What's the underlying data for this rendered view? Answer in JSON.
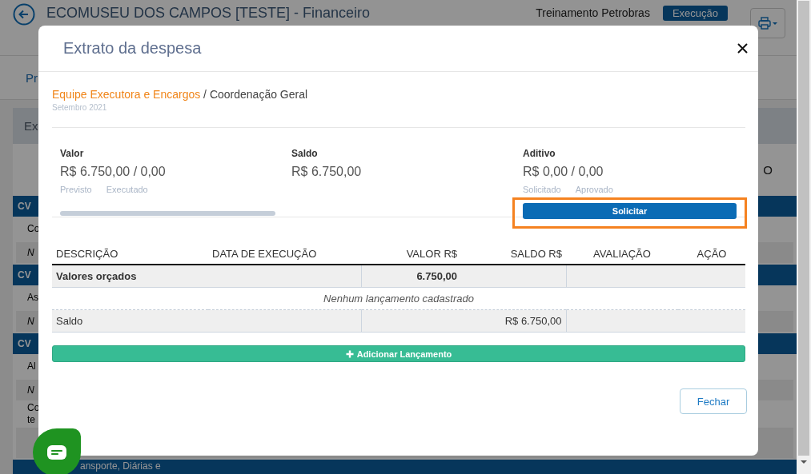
{
  "background": {
    "title": "ECOMUSEU DOS CAMPOS [TESTE] - Financeiro",
    "project": "Treinamento Petrobras",
    "status": "Execução",
    "tab": "Pr",
    "section": "Ex",
    "column_fragment": "O",
    "rows": [
      {
        "kind": "group",
        "label": "CV"
      },
      {
        "kind": "item",
        "label": "Co"
      },
      {
        "kind": "note",
        "label": "N"
      },
      {
        "kind": "group",
        "label": "CV"
      },
      {
        "kind": "item",
        "label": "As"
      },
      {
        "kind": "note",
        "label": "N"
      },
      {
        "kind": "group",
        "label": "CV"
      },
      {
        "kind": "item",
        "label": "Al"
      },
      {
        "kind": "note",
        "label": "N"
      },
      {
        "kind": "item",
        "label": "Co te"
      },
      {
        "kind": "note",
        "label": ""
      },
      {
        "kind": "group",
        "label": "ansporte, Diárias e"
      }
    ]
  },
  "modal": {
    "title": "Extrato da despesa",
    "breadcrumb": [
      {
        "kind": "link",
        "label": "Equipe Executora e Encargos"
      },
      {
        "kind": "current",
        "label": "Coordenação Geral"
      }
    ],
    "separator": "/",
    "period": "Setembro 2021",
    "summary": [
      {
        "kind": "progress",
        "label": "Valor",
        "amount": "R$ 6.750,00 / 0,00",
        "captions": [
          "Previsto",
          "Executado"
        ],
        "level": 0
      },
      {
        "kind": "plain",
        "label": "Saldo",
        "amount": "R$ 6.750,00"
      },
      {
        "kind": "action",
        "label": "Aditivo",
        "amount": "R$ 0,00 / 0,00",
        "captions": [
          "Solicitado",
          "Aprovado"
        ],
        "button": "Solicitar",
        "highlighted": true
      }
    ],
    "table": {
      "columns": [
        "DESCRIÇÃO",
        "DATA DE EXECUÇÃO",
        "VALOR R$",
        "SALDO R$",
        "AVALIAÇÃO",
        "AÇÃO"
      ],
      "rows": [
        {
          "kind": "budget",
          "label": "Valores orçados",
          "value": "6.750,00"
        },
        {
          "kind": "empty",
          "label": "Nenhum lançamento cadastrado"
        },
        {
          "kind": "balance",
          "label": "Saldo",
          "value": "R$ 6.750,00"
        }
      ]
    },
    "add_button": "Adicionar Lançamento",
    "close_button": "Fechar"
  }
}
